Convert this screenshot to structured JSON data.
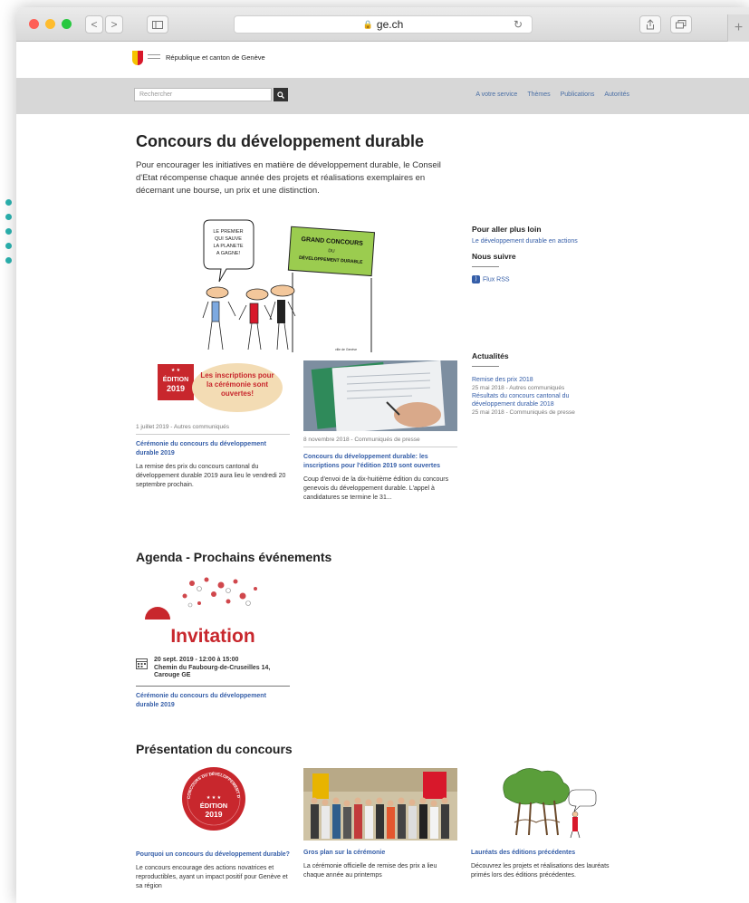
{
  "browser": {
    "url": "ge.ch",
    "back": "<",
    "forward": ">",
    "reload": "↻",
    "new_tab": "+"
  },
  "site": {
    "name": "République et canton de Genève",
    "search_placeholder": "Rechercher",
    "nav": [
      "A votre service",
      "Thèmes",
      "Publications",
      "Autorités"
    ]
  },
  "page": {
    "title": "Concours du développement durable",
    "intro": "Pour encourager les initiatives en matière de développement durable, le Conseil d'Etat récompense chaque année des projets et réalisations exemplaires en décernant une bourse, un prix et une distinction.",
    "cartoon": {
      "bubble": "LE PREMIER QUI SAUVE LA PLANETE A GAGNE!",
      "banner_line1": "GRAND CONCOURS",
      "banner_line2": "DU",
      "banner_line3": "DÉVELOPPEMENT DURABLE",
      "signature": "ville de Genève"
    }
  },
  "sidebar": {
    "further_title": "Pour aller plus loin",
    "further_link": "Le développement durable en actions",
    "follow_title": "Nous suivre",
    "rss_label": "Flux RSS",
    "news_title": "Actualités",
    "news": [
      {
        "title": "Remise des prix 2018",
        "meta": "25 mai 2018 - Autres communiqués"
      },
      {
        "title": "Résultats du concours cantonal du développement durable 2018",
        "meta": "25 mai 2018 - Communiqués de presse"
      }
    ]
  },
  "news_cards": [
    {
      "badge_line1": "ÉDITION",
      "badge_line2": "2019",
      "bubble": "Les inscriptions pour la cérémonie sont ouvertes!",
      "meta": "1 juillet 2019 - Autres communiqués",
      "title": "Cérémonie du concours du développement durable 2019",
      "text": "La remise des prix du concours cantonal du développement durable 2019 aura lieu le vendredi 20 septembre prochain."
    },
    {
      "meta": "8 novembre 2018 - Communiqués de presse",
      "title": "Concours du développement durable: les inscriptions pour l'édition 2019 sont ouvertes",
      "text": "Coup d'envoi de la dix-huitième édition du concours genevois du développement durable. L'appel à candidatures se termine le 31..."
    }
  ],
  "agenda": {
    "title": "Agenda - Prochains événements",
    "invitation": "Invitation",
    "date": "20 sept. 2019 - 12:00 à 15:00",
    "place": "Chemin du Faubourg-de-Cruseilles 14, Carouge GE",
    "link": "Cérémonie du concours du développement durable 2019"
  },
  "presentation": {
    "title": "Présentation du concours",
    "cards": [
      {
        "badge_arc": "CONCOURS DU DÉVELOPPEMENT DURABLE",
        "badge_line1": "ÉDITION",
        "badge_line2": "2019",
        "title": "Pourquoi un concours du développement durable?",
        "text": "Le concours encourage des actions novatrices et reproductibles, ayant un impact positif pour Genève et sa région"
      },
      {
        "title": "Gros plan sur la cérémonie",
        "text": "La cérémonie officielle de remise des prix a lieu chaque année au printemps"
      },
      {
        "title": "Lauréats des éditions précédentes",
        "text": "Découvrez les projets et réalisations des lauréats primés lors des éditions précédentes."
      }
    ]
  },
  "colors": {
    "accent": "#2bb3b0",
    "link": "#355ea8",
    "badge_red": "#c8272d"
  }
}
